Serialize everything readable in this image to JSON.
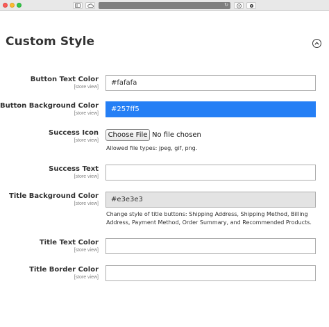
{
  "section": {
    "title": "Custom Style"
  },
  "fields": [
    {
      "label": "Button Text Color",
      "scope": "[store view]",
      "value": "#fafafa"
    },
    {
      "label": "Button Background Color",
      "scope": "[store view]",
      "value": "#257ff5"
    },
    {
      "label": "Success Icon",
      "scope": "[store view]",
      "file_button": "Choose File",
      "file_status": "No file chosen",
      "note": "Allowed file types: jpeg, gif, png."
    },
    {
      "label": "Success Text",
      "scope": "[store view]",
      "value": ""
    },
    {
      "label": "Title Background Color",
      "scope": "[store view]",
      "value": "#e3e3e3",
      "note": "Change style of title buttons: Shipping Address, Shipping Method, Billing Address, Payment Method, Order Summary, and Recommended Products."
    },
    {
      "label": "Title Text Color",
      "scope": "[store view]",
      "value": ""
    },
    {
      "label": "Title Border Color",
      "scope": "[store view]",
      "value": ""
    }
  ],
  "colors": {
    "button_background": "#257ff5",
    "title_background": "#e3e3e3"
  },
  "icons": {
    "collapse": "chevron-up-circle-icon",
    "sidebar": "sidebar-icon",
    "cloud": "cloud-icon",
    "reload": "reload-icon",
    "shield": "shield-icon",
    "privacy": "privacy-icon"
  }
}
